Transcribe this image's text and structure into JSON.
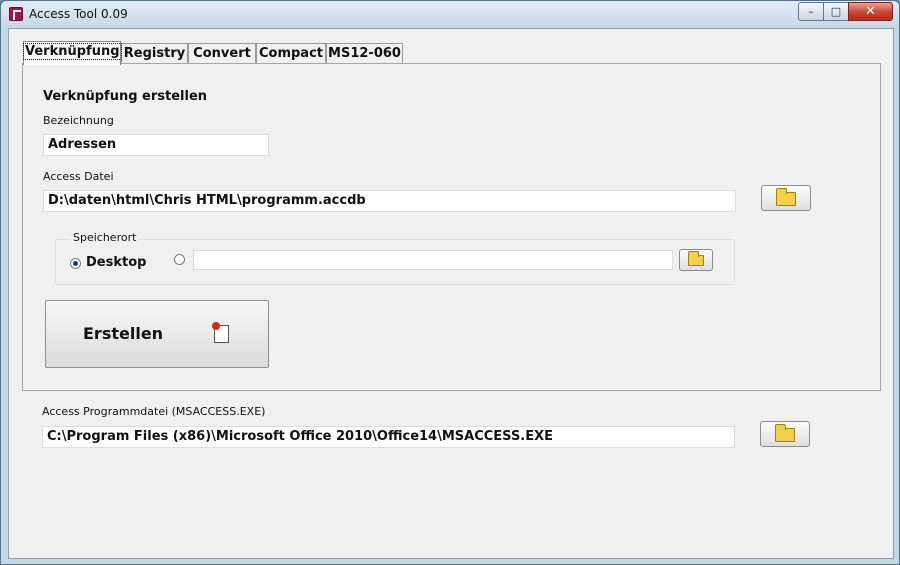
{
  "window": {
    "title": "Access Tool 0.09",
    "controls": {
      "minimize": "–",
      "maximize": "□",
      "close": "✕"
    }
  },
  "tabs": [
    {
      "label": "Verknüpfung",
      "active": true
    },
    {
      "label": "Registry",
      "active": false
    },
    {
      "label": "Convert",
      "active": false
    },
    {
      "label": "Compact",
      "active": false
    },
    {
      "label": "MS12-060",
      "active": false
    }
  ],
  "shortcut": {
    "heading": "Verknüpfung erstellen",
    "name_label": "Bezeichnung",
    "name_value": "Adressen",
    "file_label": "Access Datei",
    "file_value": "D:\\daten\\html\\Chris HTML\\programm.accdb",
    "location": {
      "label": "Speicherort",
      "desktop_label": "Desktop",
      "desktop_selected": true,
      "custom_selected": false,
      "custom_path": ""
    },
    "create_label": "Erstellen"
  },
  "program": {
    "label": "Access Programmdatei (MSACCESS.EXE)",
    "value": "C:\\Program Files (x86)\\Microsoft Office 2010\\Office14\\MSACCESS.EXE"
  },
  "icons": {
    "app": "access-app-icon",
    "browse": "folder-icon",
    "create": "new-document-icon"
  },
  "colors": {
    "window_frame": "#c7d6e4",
    "client_bg": "#f0f0f0",
    "close_button": "#c9452f",
    "folder": "#f2d049"
  }
}
